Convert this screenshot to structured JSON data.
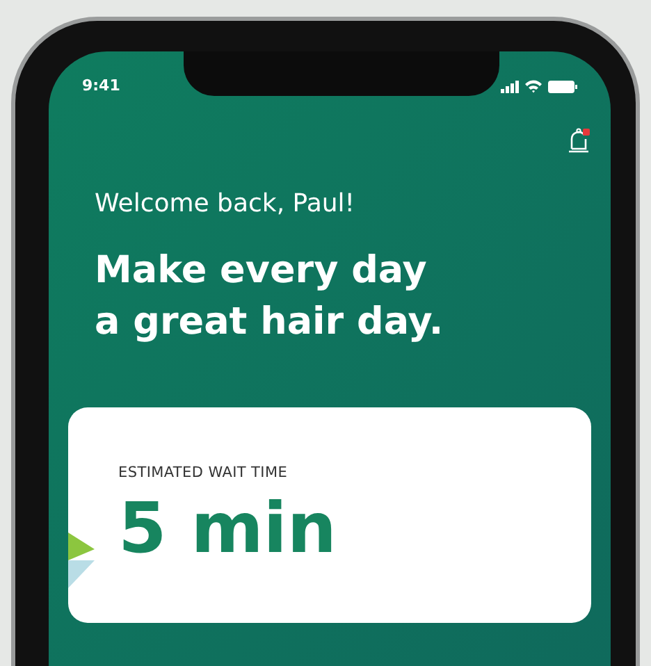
{
  "status_bar": {
    "time": "9:41"
  },
  "notifications": {
    "unread": true
  },
  "greeting": "Welcome back, Paul!",
  "headline_lines": [
    "Make every day",
    "a great hair day."
  ],
  "wait_card": {
    "label": "ESTIMATED WAIT TIME",
    "value": "5 min"
  }
}
